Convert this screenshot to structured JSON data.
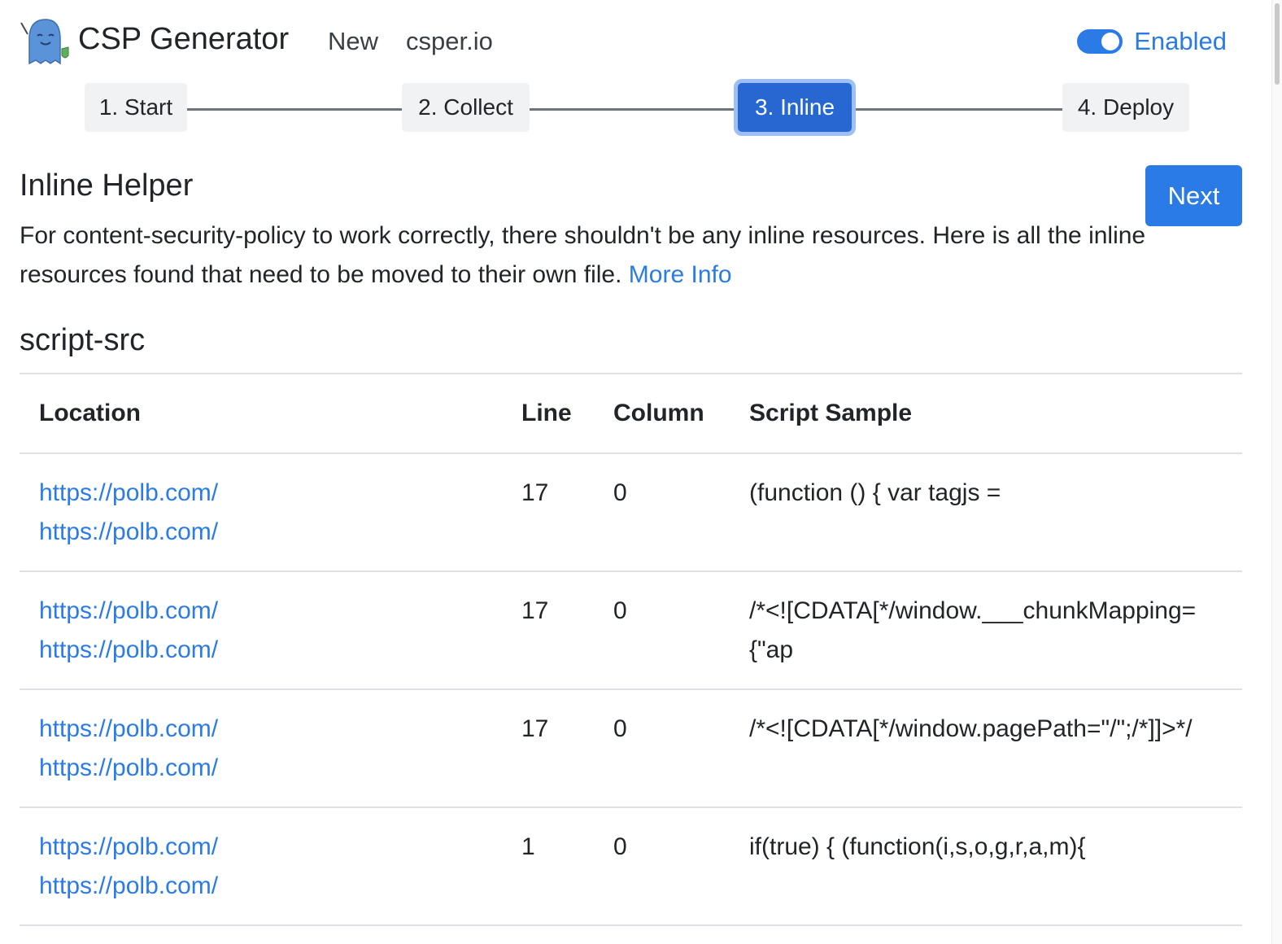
{
  "header": {
    "app_title": "CSP Generator",
    "nav": {
      "new_label": "New",
      "csper_label": "csper.io"
    },
    "toggle": {
      "label": "Enabled",
      "state": "on"
    },
    "logo_icon": "ghost-mascot-icon"
  },
  "stepper": {
    "steps": [
      {
        "label": "1. Start",
        "active": false
      },
      {
        "label": "2. Collect",
        "active": false
      },
      {
        "label": "3. Inline",
        "active": true
      },
      {
        "label": "4. Deploy",
        "active": false
      }
    ]
  },
  "main": {
    "title": "Inline Helper",
    "next_label": "Next",
    "description": "For content-security-policy to work correctly, there shouldn't be any inline resources. Here is all the inline resources found that need to be moved to their own file.",
    "more_info_label": "More Info",
    "section_title": "script-src"
  },
  "table": {
    "headers": {
      "location": "Location",
      "line": "Line",
      "column": "Column",
      "sample": "Script Sample"
    },
    "rows": [
      {
        "location_a": "https://polb.com/",
        "location_b": "https://polb.com/",
        "line": "17",
        "column": "0",
        "sample": "(function () { var tagjs ="
      },
      {
        "location_a": "https://polb.com/",
        "location_b": "https://polb.com/",
        "line": "17",
        "column": "0",
        "sample": "/*<![CDATA[*/window.___chunkMapping={\"ap"
      },
      {
        "location_a": "https://polb.com/",
        "location_b": "https://polb.com/",
        "line": "17",
        "column": "0",
        "sample": "/*<![CDATA[*/window.pagePath=\"/\";/*]]>*/"
      },
      {
        "location_a": "https://polb.com/",
        "location_b": "https://polb.com/",
        "line": "1",
        "column": "0",
        "sample": "if(true) { (function(i,s,o,g,r,a,m){"
      }
    ]
  },
  "colors": {
    "accent": "#2b7be7",
    "active_step": "#2767d2",
    "step_bg": "#f1f2f4",
    "text": "#212529"
  }
}
